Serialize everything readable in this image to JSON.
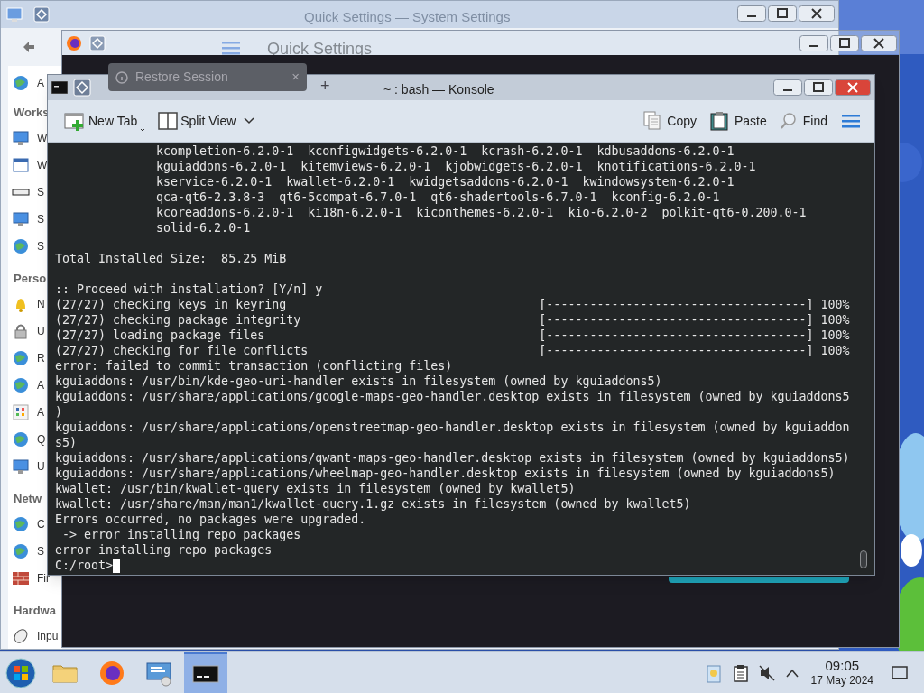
{
  "settings_window": {
    "title": "Quick Settings — System Settings",
    "heading": "Quick Settings",
    "sidebar": {
      "top_item": "A",
      "sections": [
        {
          "title": "Works",
          "items": [
            "W",
            "W",
            "S",
            "S",
            "S"
          ]
        },
        {
          "title": "Perso",
          "items": [
            "N",
            "U",
            "R",
            "A",
            "A",
            "Q",
            "U"
          ]
        },
        {
          "title": "Netw",
          "items": [
            "C",
            "S",
            "Fir"
          ]
        },
        {
          "title": "Hardwa",
          "items": [
            "Inpu"
          ]
        }
      ]
    }
  },
  "firefox_window": {
    "tab": "Restore Session",
    "tab_close": "×",
    "new_tab": "+"
  },
  "konsole": {
    "title": "~ : bash — Konsole",
    "toolbar_left": [
      {
        "label": "New Tab"
      },
      {
        "label": "Split View"
      }
    ],
    "toolbar_right": [
      {
        "label": "Copy"
      },
      {
        "label": "Paste"
      },
      {
        "label": "Find"
      }
    ],
    "lines": [
      {
        "kind": "text",
        "text": "              kcompletion-6.2.0-1  kconfigwidgets-6.2.0-1  kcrash-6.2.0-1  kdbusaddons-6.2.0-1"
      },
      {
        "kind": "text",
        "text": "              kguiaddons-6.2.0-1  kitemviews-6.2.0-1  kjobwidgets-6.2.0-1  knotifications-6.2.0-1"
      },
      {
        "kind": "text",
        "text": "              kservice-6.2.0-1  kwallet-6.2.0-1  kwidgetsaddons-6.2.0-1  kwindowsystem-6.2.0-1"
      },
      {
        "kind": "text",
        "text": "              qca-qt6-2.3.8-3  qt6-5compat-6.7.0-1  qt6-shadertools-6.7.0-1  kconfig-6.2.0-1"
      },
      {
        "kind": "text",
        "text": "              kcoreaddons-6.2.0-1  ki18n-6.2.0-1  kiconthemes-6.2.0-1  kio-6.2.0-2  polkit-qt6-0.200.0-1"
      },
      {
        "kind": "text",
        "text": "              solid-6.2.0-1"
      },
      {
        "kind": "blank"
      },
      {
        "kind": "text",
        "text": "Total Installed Size:  85.25 MiB"
      },
      {
        "kind": "blank"
      },
      {
        "kind": "text",
        "text": ":: Proceed with installation? [Y/n] y"
      },
      {
        "kind": "progress",
        "text": "(27/27) checking keys in keyring",
        "bar": "[------------------------------------]",
        "percent": "100%"
      },
      {
        "kind": "progress",
        "text": "(27/27) checking package integrity",
        "bar": "[------------------------------------]",
        "percent": "100%"
      },
      {
        "kind": "progress",
        "text": "(27/27) loading package files",
        "bar": "[------------------------------------]",
        "percent": "100%"
      },
      {
        "kind": "progress",
        "text": "(27/27) checking for file conflicts",
        "bar": "[------------------------------------]",
        "percent": "100%"
      },
      {
        "kind": "text",
        "text": "error: failed to commit transaction (conflicting files)"
      },
      {
        "kind": "text",
        "text": "kguiaddons: /usr/bin/kde-geo-uri-handler exists in filesystem (owned by kguiaddons5)"
      },
      {
        "kind": "text",
        "text": "kguiaddons: /usr/share/applications/google-maps-geo-handler.desktop exists in filesystem (owned by kguiaddons5"
      },
      {
        "kind": "text",
        "text": ")"
      },
      {
        "kind": "text",
        "text": "kguiaddons: /usr/share/applications/openstreetmap-geo-handler.desktop exists in filesystem (owned by kguiaddon"
      },
      {
        "kind": "text",
        "text": "s5)"
      },
      {
        "kind": "text",
        "text": "kguiaddons: /usr/share/applications/qwant-maps-geo-handler.desktop exists in filesystem (owned by kguiaddons5)"
      },
      {
        "kind": "text",
        "text": "kguiaddons: /usr/share/applications/wheelmap-geo-handler.desktop exists in filesystem (owned by kguiaddons5)"
      },
      {
        "kind": "text",
        "text": "kwallet: /usr/bin/kwallet-query exists in filesystem (owned by kwallet5)"
      },
      {
        "kind": "text",
        "text": "kwallet: /usr/share/man/man1/kwallet-query.1.gz exists in filesystem (owned by kwallet5)"
      },
      {
        "kind": "text",
        "text": "Errors occurred, no packages were upgraded."
      },
      {
        "kind": "text",
        "text": " -> error installing repo packages"
      },
      {
        "kind": "text",
        "text": "error installing repo packages"
      },
      {
        "kind": "prompt",
        "text": "C:/root>"
      }
    ]
  },
  "taskbar": {
    "apps": [
      {
        "selected": false
      },
      {
        "selected": false
      },
      {
        "selected": false
      },
      {
        "selected": true
      }
    ],
    "clock": {
      "time": "09:05",
      "date": "17 May 2024"
    }
  }
}
